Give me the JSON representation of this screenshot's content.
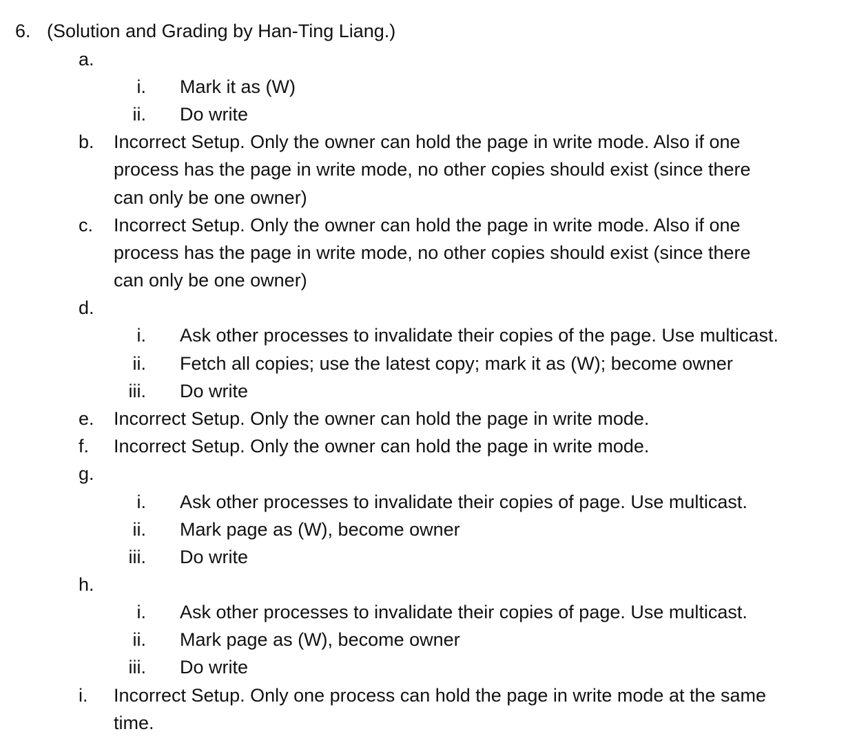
{
  "question": {
    "number": "6.",
    "title": "(Solution and Grading by Han-Ting Liang.)"
  },
  "items": {
    "a": {
      "label": "a.",
      "subitems": [
        {
          "label": "i.",
          "text": "Mark it as (W)"
        },
        {
          "label": "ii.",
          "text": "Do write"
        }
      ]
    },
    "b": {
      "label": "b.",
      "lines": [
        "Incorrect Setup. Only the owner can hold the page in write mode. Also if one",
        "process has the page in write mode, no other copies should exist (since there",
        "can only be one owner)"
      ]
    },
    "c": {
      "label": "c.",
      "lines": [
        "Incorrect Setup. Only the owner can hold the page in write mode. Also if one",
        "process has the page in write mode, no other copies should exist (since there",
        "can only be one owner)"
      ]
    },
    "d": {
      "label": "d.",
      "subitems": [
        {
          "label": "i.",
          "text": "Ask other processes to invalidate their copies of the page. Use multicast."
        },
        {
          "label": "ii.",
          "text": "Fetch all copies; use the latest copy; mark it as (W); become owner"
        },
        {
          "label": "iii.",
          "text": "Do write"
        }
      ]
    },
    "e": {
      "label": "e.",
      "lines": [
        "Incorrect Setup. Only the owner can hold the page in write mode."
      ]
    },
    "f": {
      "label": "f.",
      "lines": [
        "Incorrect Setup. Only the owner can hold the page in write mode."
      ]
    },
    "g": {
      "label": "g.",
      "subitems": [
        {
          "label": "i.",
          "text": "Ask other processes to invalidate their copies of page. Use multicast."
        },
        {
          "label": "ii.",
          "text": "Mark page as (W), become owner"
        },
        {
          "label": "iii.",
          "text": "Do write"
        }
      ]
    },
    "h": {
      "label": "h.",
      "subitems": [
        {
          "label": "i.",
          "text": "Ask other processes to invalidate their copies of page. Use multicast."
        },
        {
          "label": "ii.",
          "text": "Mark page as (W), become owner"
        },
        {
          "label": "iii.",
          "text": "Do write"
        }
      ]
    },
    "i": {
      "label": "i.",
      "lines": [
        "Incorrect Setup. Only one process can hold the page in write mode at the same",
        "time."
      ]
    }
  }
}
